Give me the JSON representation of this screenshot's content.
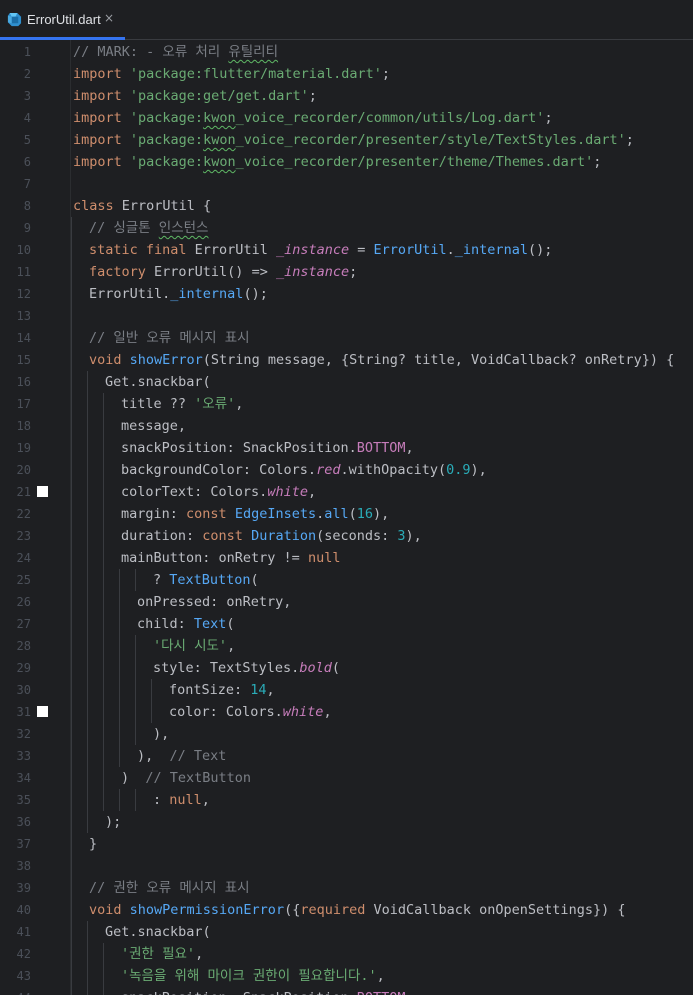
{
  "tab": {
    "label": "ErrorUtil.dart",
    "close_glyph": "×",
    "icon": "dart-file-icon",
    "accent_color": "#3574f0"
  },
  "breakpoint_lines": [
    21,
    31
  ],
  "lines": [
    {
      "n": "1",
      "indent": 0,
      "tokens": [
        [
          "c",
          "// MARK: - 오류 처리 "
        ],
        [
          "cs",
          "유틸리티"
        ]
      ]
    },
    {
      "n": "2",
      "indent": 0,
      "tokens": [
        [
          "k",
          "import "
        ],
        [
          "s",
          "'package:flutter/material.dart'"
        ],
        [
          "p",
          ";"
        ]
      ]
    },
    {
      "n": "3",
      "indent": 0,
      "tokens": [
        [
          "k",
          "import "
        ],
        [
          "s",
          "'package:get/get.dart'"
        ],
        [
          "p",
          ";"
        ]
      ]
    },
    {
      "n": "4",
      "indent": 0,
      "tokens": [
        [
          "k",
          "import "
        ],
        [
          "s",
          "'package:"
        ],
        [
          "ss",
          "kwon"
        ],
        [
          "s",
          "_voice_recorder/common/utils/Log.dart'"
        ],
        [
          "p",
          ";"
        ]
      ]
    },
    {
      "n": "5",
      "indent": 0,
      "tokens": [
        [
          "k",
          "import "
        ],
        [
          "s",
          "'package:"
        ],
        [
          "ss",
          "kwon"
        ],
        [
          "s",
          "_voice_recorder/presenter/style/TextStyles.dart'"
        ],
        [
          "p",
          ";"
        ]
      ]
    },
    {
      "n": "6",
      "indent": 0,
      "tokens": [
        [
          "k",
          "import "
        ],
        [
          "s",
          "'package:"
        ],
        [
          "ss",
          "kwon"
        ],
        [
          "s",
          "_voice_recorder/presenter/theme/Themes.dart'"
        ],
        [
          "p",
          ";"
        ]
      ]
    },
    {
      "n": "7",
      "indent": 0,
      "tokens": []
    },
    {
      "n": "8",
      "indent": 0,
      "tokens": [
        [
          "k",
          "class "
        ],
        [
          "p",
          "ErrorUtil {"
        ]
      ]
    },
    {
      "n": "9",
      "indent": 1,
      "tokens": [
        [
          "c",
          "// 싱글톤 "
        ],
        [
          "cs",
          "인스턴스"
        ]
      ]
    },
    {
      "n": "10",
      "indent": 1,
      "tokens": [
        [
          "k",
          "static final "
        ],
        [
          "p",
          "ErrorUtil "
        ],
        [
          "fi",
          "_instance"
        ],
        [
          "p",
          " = "
        ],
        [
          "t",
          "ErrorUtil"
        ],
        [
          "p",
          "."
        ],
        [
          "ft",
          "_internal"
        ],
        [
          "p",
          "();"
        ]
      ]
    },
    {
      "n": "11",
      "indent": 1,
      "tokens": [
        [
          "k",
          "factory "
        ],
        [
          "p",
          "ErrorUtil() => "
        ],
        [
          "fi",
          "_instance"
        ],
        [
          "p",
          ";"
        ]
      ]
    },
    {
      "n": "12",
      "indent": 1,
      "tokens": [
        [
          "p",
          "ErrorUtil."
        ],
        [
          "ft",
          "_internal"
        ],
        [
          "p",
          "();"
        ]
      ]
    },
    {
      "n": "13",
      "indent": 1,
      "tokens": []
    },
    {
      "n": "14",
      "indent": 1,
      "tokens": [
        [
          "c",
          "// 일반 오류 메시지 표시"
        ]
      ]
    },
    {
      "n": "15",
      "indent": 1,
      "tokens": [
        [
          "k",
          "void "
        ],
        [
          "f",
          "showError"
        ],
        [
          "p",
          "(String message, {String? title, VoidCallback? onRetry}) {"
        ]
      ]
    },
    {
      "n": "16",
      "indent": 2,
      "tokens": [
        [
          "p",
          "Get.snackbar("
        ]
      ]
    },
    {
      "n": "17",
      "indent": 3,
      "tokens": [
        [
          "p",
          "title ?? "
        ],
        [
          "s",
          "'오류'"
        ],
        [
          "p",
          ","
        ]
      ]
    },
    {
      "n": "18",
      "indent": 3,
      "tokens": [
        [
          "p",
          "message,"
        ]
      ]
    },
    {
      "n": "19",
      "indent": 3,
      "tokens": [
        [
          "p",
          "snackPosition: SnackPosition."
        ],
        [
          "e",
          "BOTTOM"
        ],
        [
          "p",
          ","
        ]
      ]
    },
    {
      "n": "20",
      "indent": 3,
      "tokens": [
        [
          "p",
          "backgroundColor: Colors."
        ],
        [
          "fi",
          "red"
        ],
        [
          "p",
          ".withOpacity("
        ],
        [
          "n",
          "0.9"
        ],
        [
          "p",
          "),"
        ]
      ]
    },
    {
      "n": "21",
      "indent": 3,
      "tokens": [
        [
          "p",
          "colorText: Colors."
        ],
        [
          "fi",
          "white"
        ],
        [
          "p",
          ","
        ]
      ]
    },
    {
      "n": "22",
      "indent": 3,
      "tokens": [
        [
          "p",
          "margin: "
        ],
        [
          "k",
          "const "
        ],
        [
          "t",
          "EdgeInsets"
        ],
        [
          "p",
          "."
        ],
        [
          "t",
          "all"
        ],
        [
          "p",
          "("
        ],
        [
          "n",
          "16"
        ],
        [
          "p",
          "),"
        ]
      ]
    },
    {
      "n": "23",
      "indent": 3,
      "tokens": [
        [
          "p",
          "duration: "
        ],
        [
          "k",
          "const "
        ],
        [
          "t",
          "Duration"
        ],
        [
          "p",
          "(seconds: "
        ],
        [
          "n",
          "3"
        ],
        [
          "p",
          "),"
        ]
      ]
    },
    {
      "n": "24",
      "indent": 3,
      "tokens": [
        [
          "p",
          "mainButton: onRetry != "
        ],
        [
          "k",
          "null"
        ]
      ]
    },
    {
      "n": "25",
      "indent": 5,
      "tokens": [
        [
          "p",
          "? "
        ],
        [
          "t",
          "TextButton"
        ],
        [
          "p",
          "("
        ]
      ]
    },
    {
      "n": "26",
      "indent": 4,
      "tokens": [
        [
          "p",
          "onPressed: onRetry,"
        ]
      ]
    },
    {
      "n": "27",
      "indent": 4,
      "tokens": [
        [
          "p",
          "child: "
        ],
        [
          "t",
          "Text"
        ],
        [
          "p",
          "("
        ]
      ]
    },
    {
      "n": "28",
      "indent": 5,
      "tokens": [
        [
          "s",
          "'다시 시도'"
        ],
        [
          "p",
          ","
        ]
      ]
    },
    {
      "n": "29",
      "indent": 5,
      "tokens": [
        [
          "p",
          "style: TextStyles."
        ],
        [
          "fi",
          "bold"
        ],
        [
          "p",
          "("
        ]
      ]
    },
    {
      "n": "30",
      "indent": 6,
      "tokens": [
        [
          "p",
          "fontSize: "
        ],
        [
          "n",
          "14"
        ],
        [
          "p",
          ","
        ]
      ]
    },
    {
      "n": "31",
      "indent": 6,
      "tokens": [
        [
          "p",
          "color: Colors."
        ],
        [
          "fi",
          "white"
        ],
        [
          "p",
          ","
        ]
      ]
    },
    {
      "n": "32",
      "indent": 5,
      "tokens": [
        [
          "p",
          "),"
        ]
      ]
    },
    {
      "n": "33",
      "indent": 4,
      "tokens": [
        [
          "p",
          "),  "
        ],
        [
          "c",
          "// Text"
        ]
      ]
    },
    {
      "n": "34",
      "indent": 3,
      "tokens": [
        [
          "p",
          ")  "
        ],
        [
          "c",
          "// TextButton"
        ]
      ]
    },
    {
      "n": "35",
      "indent": 5,
      "tokens": [
        [
          "p",
          ": "
        ],
        [
          "k",
          "null"
        ],
        [
          "p",
          ","
        ]
      ]
    },
    {
      "n": "36",
      "indent": 2,
      "tokens": [
        [
          "p",
          ");"
        ]
      ]
    },
    {
      "n": "37",
      "indent": 1,
      "tokens": [
        [
          "p",
          "}"
        ]
      ]
    },
    {
      "n": "38",
      "indent": 1,
      "tokens": []
    },
    {
      "n": "39",
      "indent": 1,
      "tokens": [
        [
          "c",
          "// 권한 오류 메시지 표시"
        ]
      ]
    },
    {
      "n": "40",
      "indent": 1,
      "tokens": [
        [
          "k",
          "void "
        ],
        [
          "f",
          "showPermissionError"
        ],
        [
          "p",
          "({"
        ],
        [
          "k",
          "required "
        ],
        [
          "p",
          "VoidCallback onOpenSettings}) {"
        ]
      ]
    },
    {
      "n": "41",
      "indent": 2,
      "tokens": [
        [
          "p",
          "Get.snackbar("
        ]
      ]
    },
    {
      "n": "42",
      "indent": 3,
      "tokens": [
        [
          "s",
          "'권한 필요'"
        ],
        [
          "p",
          ","
        ]
      ]
    },
    {
      "n": "43",
      "indent": 3,
      "tokens": [
        [
          "s",
          "'녹음을 위해 마이크 권한이 필요합니다.'"
        ],
        [
          "p",
          ","
        ]
      ]
    },
    {
      "n": "44",
      "indent": 3,
      "tokens": [
        [
          "p",
          "snackPosition: SnackPosition."
        ],
        [
          "e",
          "BOTTOM"
        ],
        [
          "p",
          ","
        ]
      ]
    }
  ]
}
